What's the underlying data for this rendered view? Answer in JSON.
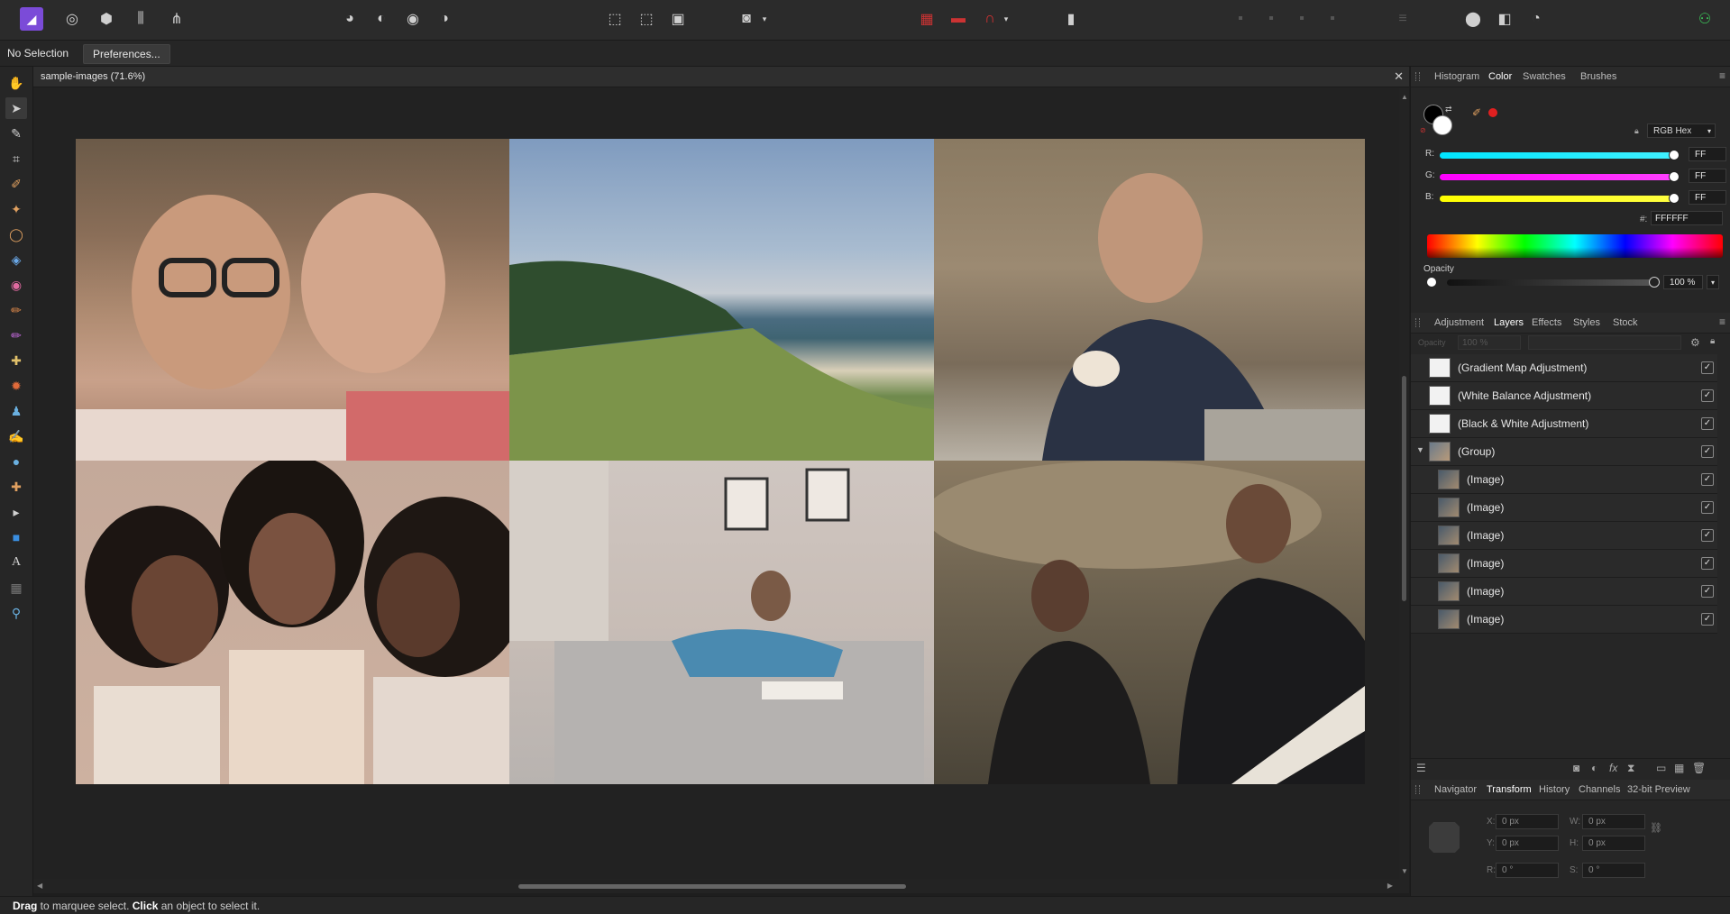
{
  "context_bar": {
    "selection": "No Selection",
    "preferences": "Preferences..."
  },
  "document": {
    "title": "sample-images (71.6%)"
  },
  "status": {
    "drag": "Drag",
    "drag_rest": " to marquee select. ",
    "click": "Click",
    "click_rest": " an object to select it."
  },
  "panels": {
    "top_tabs": [
      "Histogram",
      "Color",
      "Swatches",
      "Brushes"
    ],
    "color": {
      "mode": "RGB Hex",
      "channels": [
        {
          "label": "R:",
          "value": "FF"
        },
        {
          "label": "G:",
          "value": "FF"
        },
        {
          "label": "B:",
          "value": "FF"
        }
      ],
      "hex_label": "#:",
      "hex_value": "FFFFFF",
      "opacity_label": "Opacity",
      "opacity_value": "100 %"
    },
    "mid_tabs": [
      "Adjustment",
      "Layers",
      "Effects",
      "Styles",
      "Stock"
    ],
    "layers": {
      "opacity_label": "Opacity",
      "opacity_value": "100 %",
      "items": [
        {
          "name": "(Gradient Map Adjustment)",
          "kind": "adjustment",
          "visible": true
        },
        {
          "name": "(White Balance Adjustment)",
          "kind": "adjustment",
          "visible": true
        },
        {
          "name": "(Black & White Adjustment)",
          "kind": "adjustment",
          "visible": true
        },
        {
          "name": "(Group)",
          "kind": "group",
          "visible": true
        },
        {
          "name": "(Image)",
          "kind": "image",
          "visible": true
        },
        {
          "name": "(Image)",
          "kind": "image",
          "visible": true
        },
        {
          "name": "(Image)",
          "kind": "image",
          "visible": true
        },
        {
          "name": "(Image)",
          "kind": "image",
          "visible": true
        },
        {
          "name": "(Image)",
          "kind": "image",
          "visible": true
        },
        {
          "name": "(Image)",
          "kind": "image",
          "visible": true
        }
      ]
    },
    "bottom_tabs": [
      "Navigator",
      "Transform",
      "History",
      "Channels",
      "32-bit Preview"
    ],
    "transform": {
      "x_label": "X:",
      "x": "0 px",
      "w_label": "W:",
      "w": "0 px",
      "y_label": "Y:",
      "y": "0 px",
      "h_label": "H:",
      "h": "0 px",
      "r_label": "R:",
      "r": "0 °",
      "s_label": "S:",
      "s": "0 °"
    }
  },
  "colors": {
    "accent": "#7b4bd8",
    "canvas_bg": "#222222",
    "panel_bg": "#262626"
  },
  "icons": {
    "tools": [
      "hand-icon",
      "move-icon",
      "pen-icon",
      "crop-icon",
      "eyedropper-icon",
      "selection-brush-icon",
      "marquee-icon",
      "flood-fill-icon",
      "color-picker-icon",
      "paint-brush-icon",
      "overlay-brush-icon",
      "clone-brush-icon",
      "burn-icon",
      "dodge-icon",
      "smudge-icon",
      "blur-icon",
      "healing-icon",
      "node-icon",
      "rectangle-icon",
      "text-icon",
      "mesh-icon",
      "zoom-icon"
    ]
  }
}
